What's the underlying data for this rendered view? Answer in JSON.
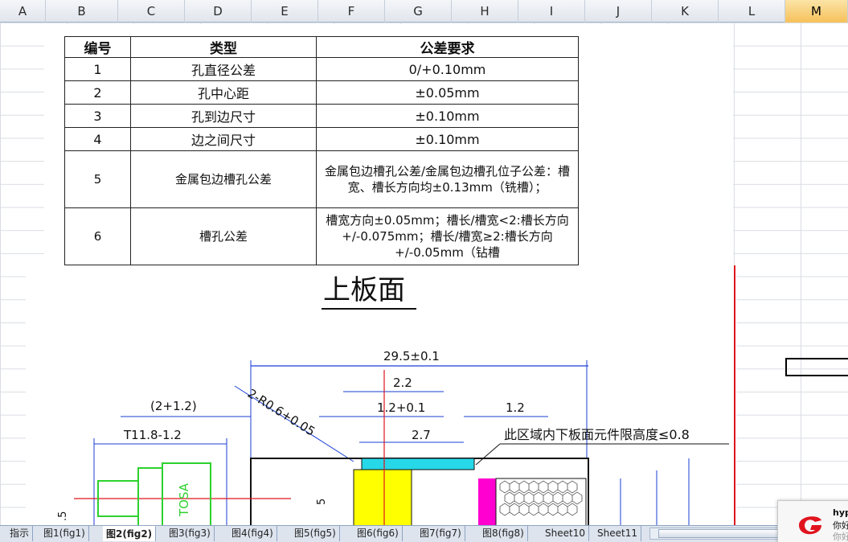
{
  "columns": [
    "A",
    "B",
    "C",
    "D",
    "E",
    "F",
    "G",
    "H",
    "I",
    "J",
    "K",
    "L",
    "M"
  ],
  "selected_column": "M",
  "table": {
    "headers": [
      "编号",
      "类型",
      "公差要求"
    ],
    "rows": [
      {
        "no": "1",
        "type": "孔直径公差",
        "req": "0/+0.10mm"
      },
      {
        "no": "2",
        "type": "孔中心距",
        "req": "±0.05mm"
      },
      {
        "no": "3",
        "type": "孔到边尺寸",
        "req": "±0.10mm"
      },
      {
        "no": "4",
        "type": "边之间尺寸",
        "req": "±0.10mm"
      },
      {
        "no": "5",
        "type": "金属包边槽孔公差",
        "req": "金属包边槽孔公差/金属包边槽孔位子公差：槽宽、槽长方向均±0.13mm（铣槽）；"
      },
      {
        "no": "6",
        "type": "槽孔公差",
        "req": "槽宽方向±0.05mm；槽长/槽宽<2:槽长方向+/-0.075mm；槽长/槽宽≥2:槽长方向+/-0.05mm（钻槽"
      }
    ]
  },
  "drawing": {
    "title": "上板面",
    "dims": {
      "overall": "29.5±0.1",
      "d22": "2.2",
      "d12p01": "1.2+0.1",
      "d12": "1.2",
      "d27": "2.7",
      "d2p12": "(2+1.2)",
      "t118": "T11.8-1.2",
      "radius": "2-R0.6+0.05",
      "note": "此区域内下板面元件限高度≤0.8",
      "v5": "5",
      "v5b": ".5"
    },
    "component_label": "TOSA"
  },
  "tabs": [
    "指示",
    "图1(fig1)",
    "图2(fig2)",
    "图3(fig3)",
    "图4(fig4)",
    "图5(fig5)",
    "图6(fig6)",
    "图7(fig7)",
    "图8(fig8)",
    "Sheet10",
    "Sheet11"
  ],
  "active_tab": "图2(fig2)",
  "notification": {
    "line1": "hyp",
    "line2": "你好",
    "line3": "你好"
  }
}
